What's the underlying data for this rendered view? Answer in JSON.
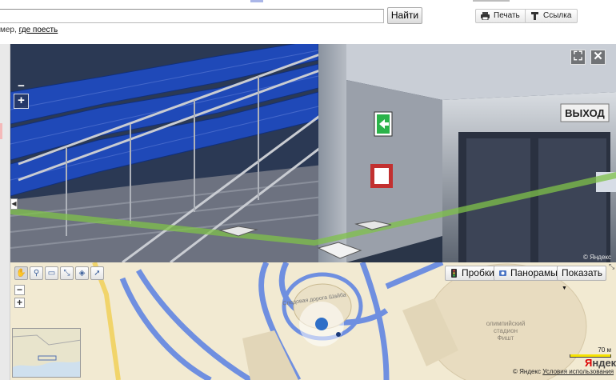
{
  "search": {
    "value": "",
    "button_label": "Найти"
  },
  "toolbar": {
    "print_label": "Печать",
    "link_label": "Ссылка"
  },
  "hint": {
    "prefix": "мер,",
    "link": "где поесть"
  },
  "panorama": {
    "exit_sign": "ВЫХОД",
    "copyright": "© Яндекс"
  },
  "map": {
    "traffic_label": "Пробки",
    "panoramas_label": "Панорамы",
    "show_label": "Показать",
    "show_arrow": "▼",
    "stadium_label_1": "олимпийский",
    "stadium_label_2": "стадион Фишт",
    "street_label": "Следовая дорога Шайба",
    "scale_label": "70 м",
    "copyright": "© Яндекс",
    "terms_link": "Условия использования",
    "logo_prefix": "Я",
    "logo_rest": "ндекс"
  },
  "colors": {
    "accent_green": "#7fc24a",
    "map_road": "#6f8fe0",
    "panorama_seats": "#1f49b8"
  }
}
